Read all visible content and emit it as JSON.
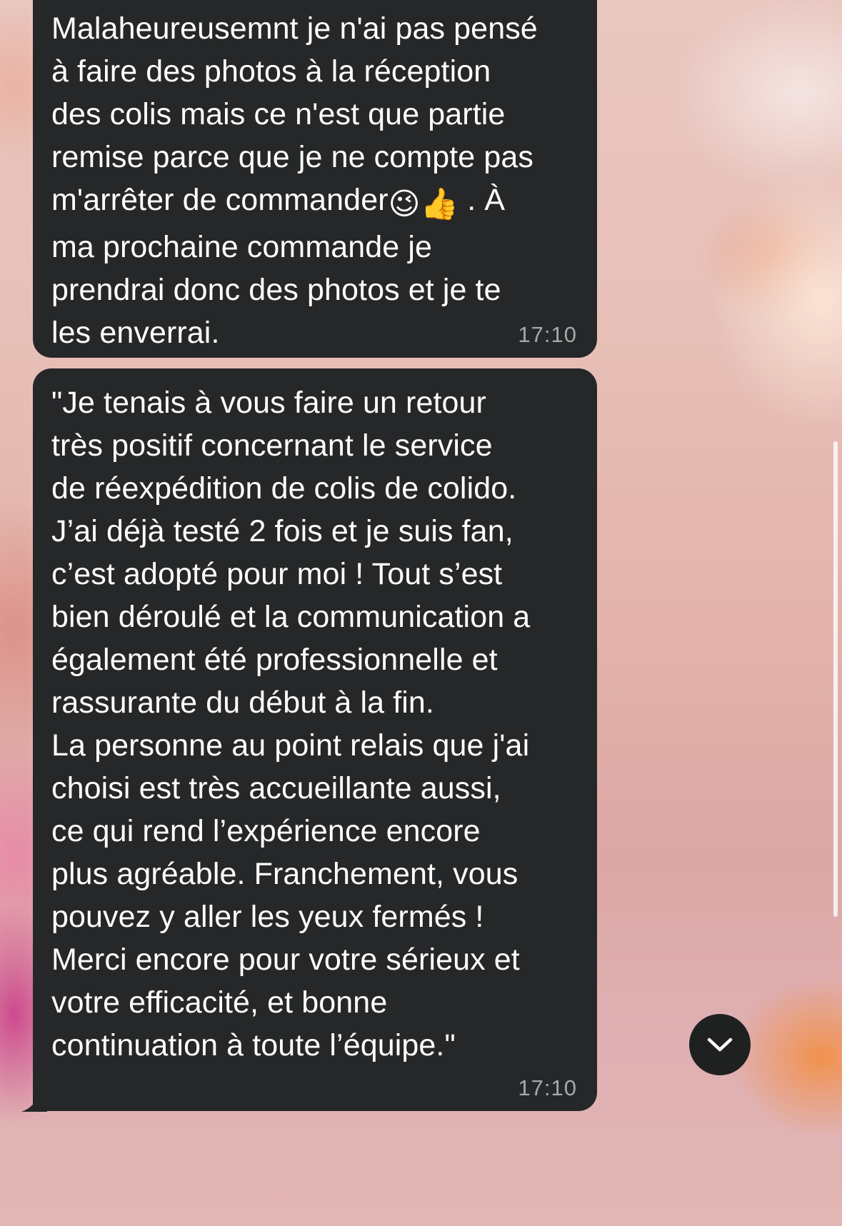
{
  "conversation": {
    "messages": [
      {
        "text_before_emoji": "Malaheureusemnt je n'ai pas pensé\nà faire des photos à la réception\ndes colis mais ce n'est que partie\nremise parce que je ne compte pas\nm'arrêter de commander",
        "emojis": [
          "😉",
          "👍"
        ],
        "text_after_emoji": " . À\nma prochaine commande je\nprendrai donc des photos et je te\nles enverrai.",
        "time": "17:10"
      },
      {
        "text": "\"Je tenais à vous faire un retour\ntrès positif concernant le service\nde réexpédition de colis de colido.\nJ’ai déjà testé 2 fois et je suis fan,\nc’est adopté pour moi ! Tout s’est\nbien déroulé et la communication a\négalement été professionnelle et\nrassurante du début à la fin.\nLa personne au point relais que j'ai\nchoisi est très accueillante aussi,\nce qui rend l’expérience encore\nplus agréable. Franchement, vous\npouvez y aller les yeux fermés !\nMerci encore pour votre sérieux et\nvotre efficacité, et bonne\ncontinuation à toute l’équipe.\"",
        "time": "17:10"
      }
    ],
    "scroll_down_icon": "chevron-down-icon",
    "colors": {
      "bubble": "#252728",
      "text": "#ffffff",
      "timestamp": "#a6a8aa"
    }
  }
}
